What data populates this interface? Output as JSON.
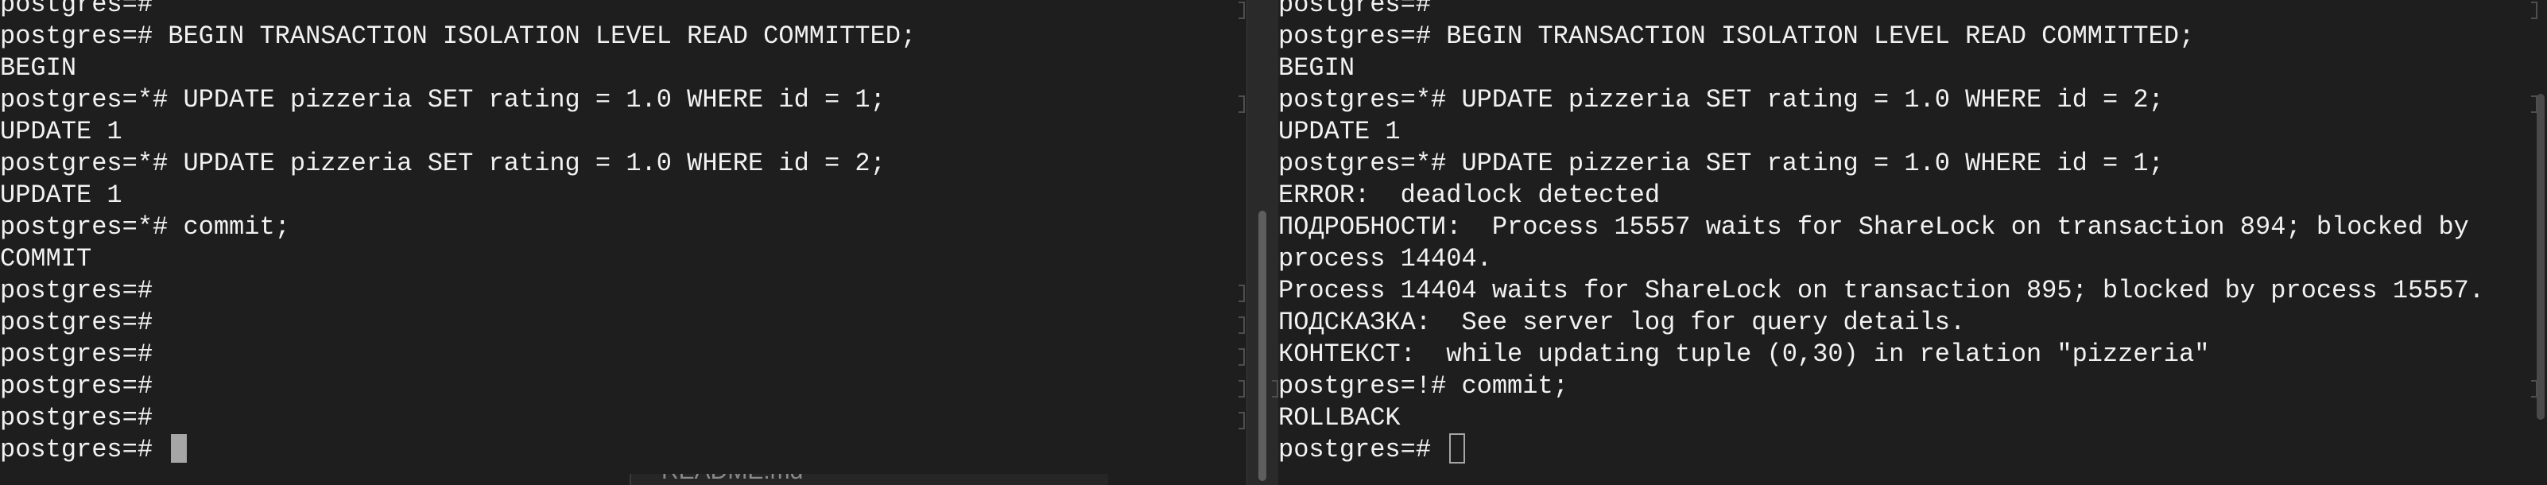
{
  "left_terminal": {
    "lines": [
      "postgres=#",
      "postgres=# BEGIN TRANSACTION ISOLATION LEVEL READ COMMITTED;",
      "BEGIN",
      "postgres=*# UPDATE pizzeria SET rating = 1.0 WHERE id = 1;",
      "UPDATE 1",
      "postgres=*# UPDATE pizzeria SET rating = 1.0 WHERE id = 2;",
      "UPDATE 1",
      "postgres=*# commit;",
      "COMMIT",
      "postgres=#",
      "postgres=#",
      "postgres=#",
      "postgres=#",
      "postgres=#",
      "postgres=# "
    ]
  },
  "right_terminal": {
    "lines": [
      "postgres=#",
      "postgres=# BEGIN TRANSACTION ISOLATION LEVEL READ COMMITTED;",
      "BEGIN",
      "postgres=*# UPDATE pizzeria SET rating = 1.0 WHERE id = 2;",
      "UPDATE 1",
      "postgres=*# UPDATE pizzeria SET rating = 1.0 WHERE id = 1;",
      "ERROR:  deadlock detected",
      "ПОДРОБНОСТИ:  Process 15557 waits for ShareLock on transaction 894; blocked by",
      "process 14404.",
      "Process 14404 waits for ShareLock on transaction 895; blocked by process 15557.",
      "ПОДСКАЗКА:  See server log for query details.",
      "КОНТЕКСТ:  while updating tuple (0,30) in relation \"pizzeria\"",
      "postgres=!# commit;",
      "ROLLBACK",
      "postgres=# "
    ]
  },
  "background_window": {
    "label": "README.md"
  }
}
